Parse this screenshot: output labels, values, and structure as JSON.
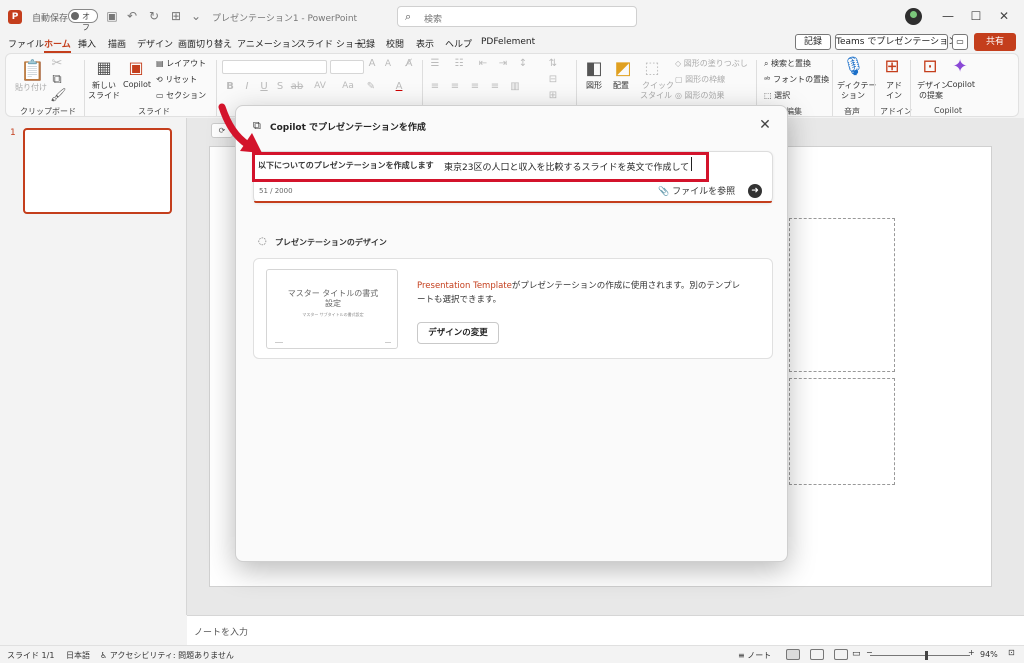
{
  "titlebar": {
    "logo": "P",
    "autosave_label": "自動保存",
    "autosave_state": "オフ",
    "doc_title": "プレゼンテーション1 - PowerPoint",
    "search_placeholder": "検索"
  },
  "menu": {
    "tabs": [
      "ファイル",
      "ホーム",
      "挿入",
      "描画",
      "デザイン",
      "画面切り替え",
      "アニメーション",
      "スライド ショー",
      "記録",
      "校閲",
      "表示",
      "ヘルプ",
      "PDFelement"
    ],
    "active_tab": "ホーム",
    "record_btn": "記録",
    "teams_btn": "Teams でプレゼンテーション",
    "share_btn": "共有"
  },
  "ribbon": {
    "clipboard": {
      "paste": "貼り付け",
      "group": "クリップボード"
    },
    "slides": {
      "new_slide": "新しい",
      "new_slide_2": "スライド",
      "copilot": "Copilot",
      "layout": "レイアウト",
      "reset": "リセット",
      "section": "セクション",
      "group": "スライド"
    },
    "drawing": {
      "shapes": "図形",
      "arrange": "配置",
      "quick_styles_1": "クイック",
      "quick_styles_2": "スタイル",
      "fill": "図形の塗りつぶし",
      "outline": "図形の枠線",
      "effects": "図形の効果"
    },
    "editing": {
      "find_replace": "検索と置換",
      "replace_font": "フォントの置換",
      "select": "選択",
      "group": "編集"
    },
    "voice": {
      "dictate_1": "ディクテー",
      "dictate_2": "ション",
      "group": "音声"
    },
    "addin": {
      "addin_1": "アド",
      "addin_2": "イン",
      "group": "アドイン"
    },
    "copilot": {
      "designer_1": "デザイン",
      "designer_2": "の提案",
      "copilot": "Copilot",
      "group": "Copilot"
    }
  },
  "thumbnail": {
    "number": "1"
  },
  "notes_placeholder": "ノートを入力",
  "status": {
    "slide": "スライド 1/1",
    "language": "日本語",
    "accessibility": "アクセシビリティ: 問題ありません",
    "notes": "ノート",
    "zoom": "94%"
  },
  "dialog": {
    "title": "Copilot でプレゼンテーションを作成",
    "prefix": "以下についてのプレゼンテーションを作成します",
    "prompt": "東京23区の人口と収入を比較するスライドを英文で作成して",
    "counter": "51 / 2000",
    "attach": "ファイルを参照",
    "design_heading": "プレゼンテーションのデザイン",
    "template_title_1": "マスター タイトルの書式",
    "template_title_2": "設定",
    "template_subtitle": "マスター サブタイトルの書式設定",
    "template_link": "Presentation Template",
    "template_desc_1": "がプレゼンテーションの作成に使用されます。別のテンプレ",
    "template_desc_2": "ートも選択できます。",
    "change_design": "デザインの変更"
  },
  "colors": {
    "accent": "#c43e1c",
    "highlight": "#d3132b"
  }
}
